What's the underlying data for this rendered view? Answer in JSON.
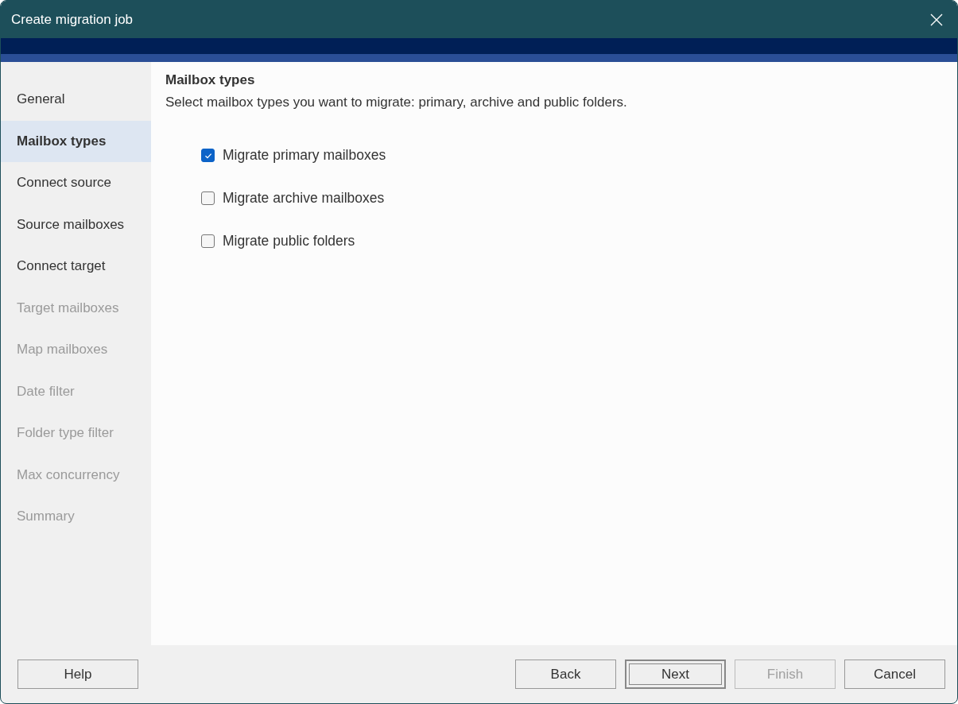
{
  "window": {
    "title": "Create migration job"
  },
  "sidebar": {
    "items": [
      {
        "label": "General",
        "selected": false,
        "disabled": false
      },
      {
        "label": "Mailbox types",
        "selected": true,
        "disabled": false
      },
      {
        "label": "Connect source",
        "selected": false,
        "disabled": false
      },
      {
        "label": "Source mailboxes",
        "selected": false,
        "disabled": false
      },
      {
        "label": "Connect target",
        "selected": false,
        "disabled": false
      },
      {
        "label": "Target mailboxes",
        "selected": false,
        "disabled": true
      },
      {
        "label": "Map mailboxes",
        "selected": false,
        "disabled": true
      },
      {
        "label": "Date filter",
        "selected": false,
        "disabled": true
      },
      {
        "label": "Folder type filter",
        "selected": false,
        "disabled": true
      },
      {
        "label": "Max concurrency",
        "selected": false,
        "disabled": true
      },
      {
        "label": "Summary",
        "selected": false,
        "disabled": true
      }
    ]
  },
  "page": {
    "heading": "Mailbox types",
    "description": "Select mailbox types you want to migrate: primary, archive and public folders.",
    "options": [
      {
        "label": "Migrate primary mailboxes",
        "checked": true
      },
      {
        "label": "Migrate archive mailboxes",
        "checked": false
      },
      {
        "label": "Migrate public folders",
        "checked": false
      }
    ]
  },
  "footer": {
    "help_button": "Help",
    "buttons": [
      {
        "label": "Back",
        "default": false,
        "disabled": false
      },
      {
        "label": "Next",
        "default": true,
        "disabled": false
      },
      {
        "label": "Finish",
        "default": false,
        "disabled": true
      },
      {
        "label": "Cancel",
        "default": false,
        "disabled": false
      }
    ]
  }
}
